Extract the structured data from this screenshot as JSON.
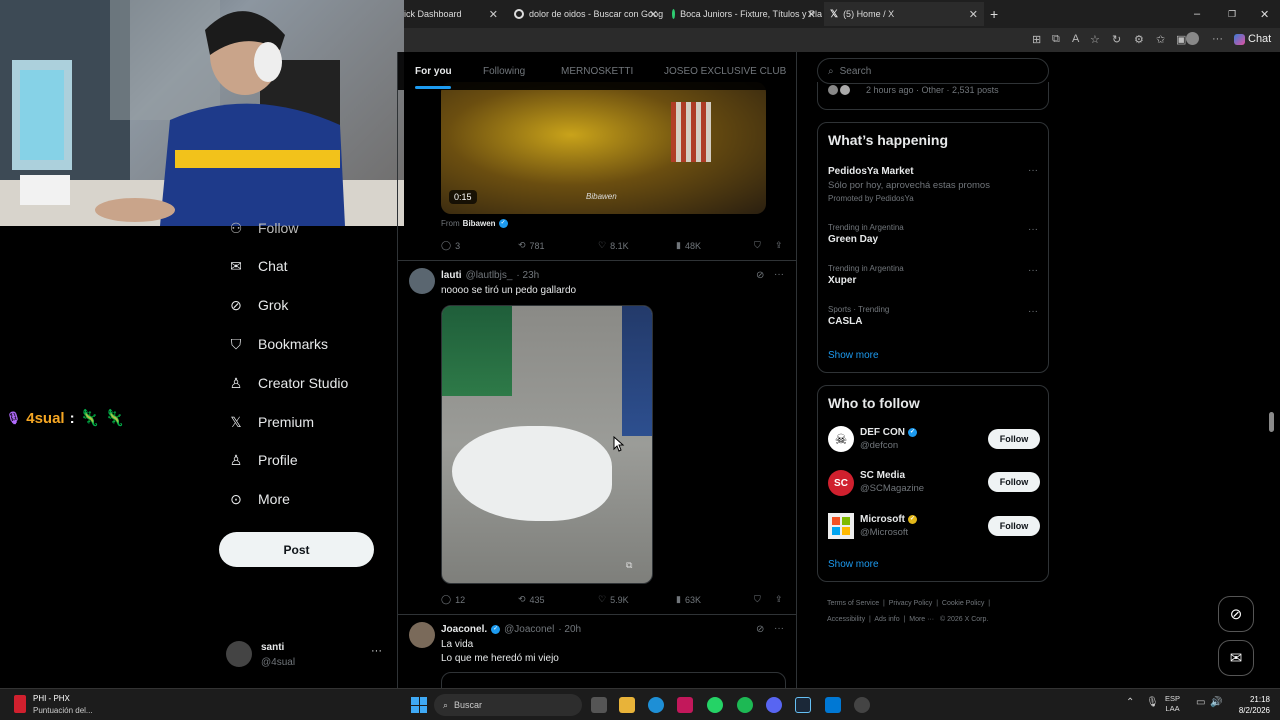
{
  "browser": {
    "tabs": [
      {
        "label": "ick Dashboard"
      },
      {
        "label": "dolor de oidos - Buscar con Goog"
      },
      {
        "label": "Boca Juniors - Fixture, Títulos y Pla"
      },
      {
        "label": "(5) Home / X"
      }
    ],
    "chat_label": "Chat"
  },
  "chat_overlay": {
    "user": "4sual",
    "separator": ":"
  },
  "nav": {
    "items": [
      {
        "label": "Follow"
      },
      {
        "label": "Chat"
      },
      {
        "label": "Grok"
      },
      {
        "label": "Bookmarks"
      },
      {
        "label": "Creator Studio"
      },
      {
        "label": "Premium"
      },
      {
        "label": "Profile"
      },
      {
        "label": "More"
      }
    ],
    "post_label": "Post",
    "account": {
      "name": "santi",
      "handle": "@4sual"
    }
  },
  "timeline": {
    "tabs": [
      "For you",
      "Following",
      "MERNOSKETTI",
      "JOSEO EXCLUSIVE CLUB"
    ],
    "video_post": {
      "duration": "0:15",
      "watermark": "Bibawen",
      "from_prefix": "From",
      "from_name": "Bibawen",
      "replies": "3",
      "reposts": "781",
      "likes": "8.1K",
      "views": "48K"
    },
    "post1": {
      "name": "lauti",
      "handle": "@lautlbjs_",
      "time": "· 23h",
      "text": "noooo se tiró un pedo gallardo",
      "replies": "12",
      "reposts": "435",
      "likes": "5.9K",
      "views": "63K"
    },
    "post2": {
      "name": "Joaconel.",
      "handle": "@Joaconel",
      "time": "· 20h",
      "line1": "La vida",
      "line2": "Lo que me heredó mi viejo"
    }
  },
  "sidebar": {
    "search_placeholder": "Search",
    "prev_card_meta": "2 hours ago · Other · 2,531 posts",
    "happening": {
      "title": "What’s happening",
      "promo": {
        "title": "PedidosYa Market",
        "desc": "Sólo por hoy, aprovechá estas promos",
        "promoted": "Promoted by PedidosYa"
      },
      "trends": [
        {
          "context": "Trending in Argentina",
          "name": "Green Day"
        },
        {
          "context": "Trending in Argentina",
          "name": "Xuper"
        },
        {
          "context": "Sports · Trending",
          "name": "CASLA"
        }
      ],
      "show_more": "Show more"
    },
    "who_to_follow": {
      "title": "Who to follow",
      "accounts": [
        {
          "name": "DEF CON",
          "handle": "@defcon",
          "follow": "Follow"
        },
        {
          "name": "SC Media",
          "handle": "@SCMagazine",
          "follow": "Follow"
        },
        {
          "name": "Microsoft",
          "handle": "@Microsoft",
          "follow": "Follow"
        }
      ],
      "show_more": "Show more"
    },
    "footer": {
      "links": [
        "Terms of Service",
        "Privacy Policy",
        "Cookie Policy",
        "Accessibility",
        "Ads info",
        "More ···"
      ],
      "copyright": "© 2026 X Corp."
    }
  },
  "taskbar": {
    "widget_title": "PHI - PHX",
    "widget_sub": "Puntuación del...",
    "search_label": "Buscar",
    "lang_line1": "ESP",
    "lang_line2": "LAA",
    "time": "21:18",
    "date": "8/2/2026"
  },
  "colors": {
    "accent": "#1d9bf0",
    "background": "#000000",
    "border": "#2f3336",
    "overlay_user": "#f5a623"
  }
}
